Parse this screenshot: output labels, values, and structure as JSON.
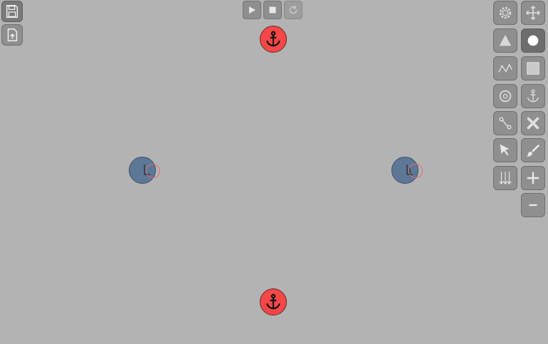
{
  "app": {
    "background": "#b3b3b3"
  },
  "file_toolbar": [
    {
      "name": "save-button",
      "icon": "floppy-disk-icon",
      "active": true
    },
    {
      "name": "export-button",
      "icon": "file-export-icon",
      "active": false
    }
  ],
  "playback": [
    {
      "name": "play-button",
      "icon": "play-icon",
      "enabled": true
    },
    {
      "name": "stop-button",
      "icon": "stop-icon",
      "enabled": true
    },
    {
      "name": "reset-button",
      "icon": "reset-icon",
      "enabled": false
    }
  ],
  "tools_left": [
    "gear-tool",
    "triangle-tool",
    "polyline-tool",
    "wheel-tool",
    "rope-tool",
    "select-tool",
    "force-tool"
  ],
  "tools_right": [
    "move-tool",
    "circle-tool",
    "box-tool",
    "anchor-tool",
    "delete-tool",
    "paint-tool",
    "zoom-in-tool",
    "zoom-out-tool"
  ],
  "colors": {
    "anchor": "#f44747",
    "body": "#5d7897",
    "joint": "#e36a72",
    "button": "#8f8f8f"
  },
  "scene": {
    "anchors": [
      "anchor-top",
      "anchor-bottom"
    ],
    "bodies": [
      "body-left",
      "body-right"
    ]
  }
}
